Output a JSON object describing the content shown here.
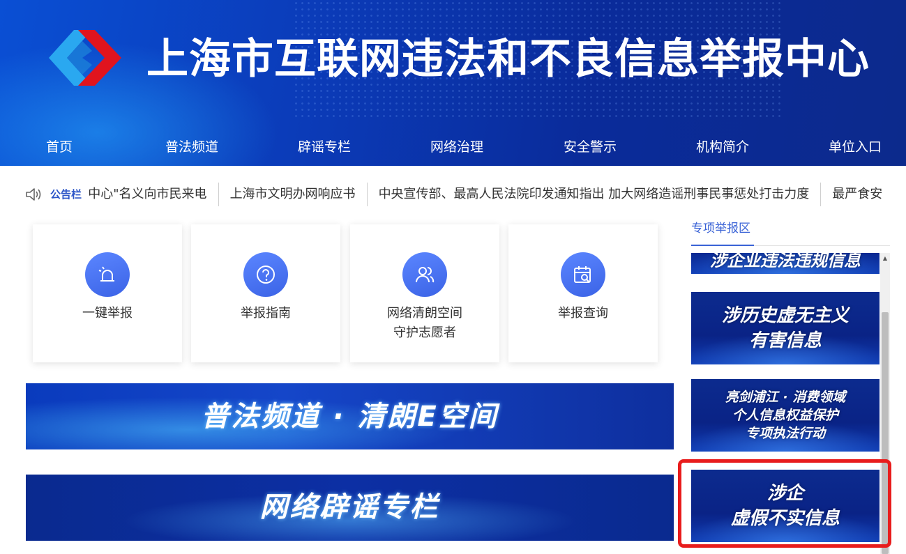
{
  "header": {
    "title": "上海市互联网违法和不良信息举报中心",
    "nav": [
      "首页",
      "普法频道",
      "辟谣专栏",
      "网络治理",
      "安全警示",
      "机构简介",
      "单位入口"
    ]
  },
  "notice": {
    "label": "公告栏",
    "items": [
      "冒用\"市互联网举报中心\"名义向市民来电",
      "上海市文明办网响应书",
      "中央宣传部、最高人民法院印发通知指出 加大网络造谣刑事民事惩处打击力度",
      "最严食安"
    ]
  },
  "cards": [
    {
      "label": "一键举报",
      "icon": "alarm-icon"
    },
    {
      "label": "举报指南",
      "icon": "question-icon"
    },
    {
      "label": "网络清朗空间\n守护志愿者",
      "icon": "volunteers-icon"
    },
    {
      "label": "举报查询",
      "icon": "calendar-search-icon"
    }
  ],
  "banners": [
    {
      "text": "普法频道 · 清朗E空间"
    },
    {
      "text": "网络辟谣专栏"
    }
  ],
  "side": {
    "title": "专项举报区",
    "items": [
      {
        "text": "涉企业违法违规信息"
      },
      {
        "text": "涉历史虚无主义\n有害信息"
      },
      {
        "text": "亮剑浦江 · 消费领域\n个人信息权益保护\n专项执法行动"
      },
      {
        "text": "涉企\n虚假不实信息"
      }
    ]
  },
  "colors": {
    "header_blue": "#0b3bb8",
    "accent": "#3a63d6",
    "icon_circle": "#4a73f0",
    "highlight_red": "#e81c1c"
  }
}
